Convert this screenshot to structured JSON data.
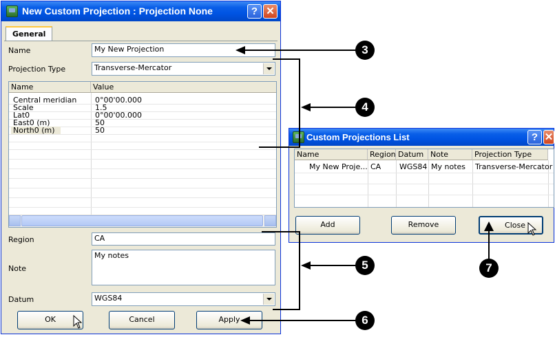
{
  "dialog": {
    "title": "New Custom Projection : Projection None",
    "help_glyph": "?",
    "close_glyph": "✕",
    "tab_general": "General",
    "name_label": "Name",
    "name_value": "My New Projection",
    "projection_type_label": "Projection Type",
    "projection_type_value": "Transverse-Mercator",
    "params_header_name": "Name",
    "params_header_value": "Value",
    "params": [
      {
        "name": "Central meridian",
        "value": "0°00'00.000"
      },
      {
        "name": "Scale",
        "value": "1.5"
      },
      {
        "name": "Lat0",
        "value": "0°00'00.000"
      },
      {
        "name": "East0 (m)",
        "value": "50"
      },
      {
        "name": "North0 (m)",
        "value": "50"
      }
    ],
    "region_label": "Region",
    "region_value": "CA",
    "note_label": "Note",
    "note_value": "My notes",
    "datum_label": "Datum",
    "datum_value": "WGS84",
    "ok_label": "OK",
    "cancel_label": "Cancel",
    "apply_label": "Apply"
  },
  "list_window": {
    "title": "Custom Projections List",
    "help_glyph": "?",
    "close_glyph": "✕",
    "columns": [
      "Name",
      "Region",
      "Datum",
      "Note",
      "Projection Type"
    ],
    "rows": [
      [
        "My New Proje...",
        "CA",
        "WGS84",
        "My notes",
        "Transverse-Mercator"
      ]
    ],
    "add_label": "Add",
    "remove_label": "Remove",
    "close_label": "Close"
  },
  "callouts": [
    "3",
    "4",
    "5",
    "6",
    "7"
  ],
  "colors": {
    "titlebar": "#0054e3",
    "window_bg": "#ece9d8",
    "close_red": "#d2451e",
    "callout": "#000000"
  }
}
